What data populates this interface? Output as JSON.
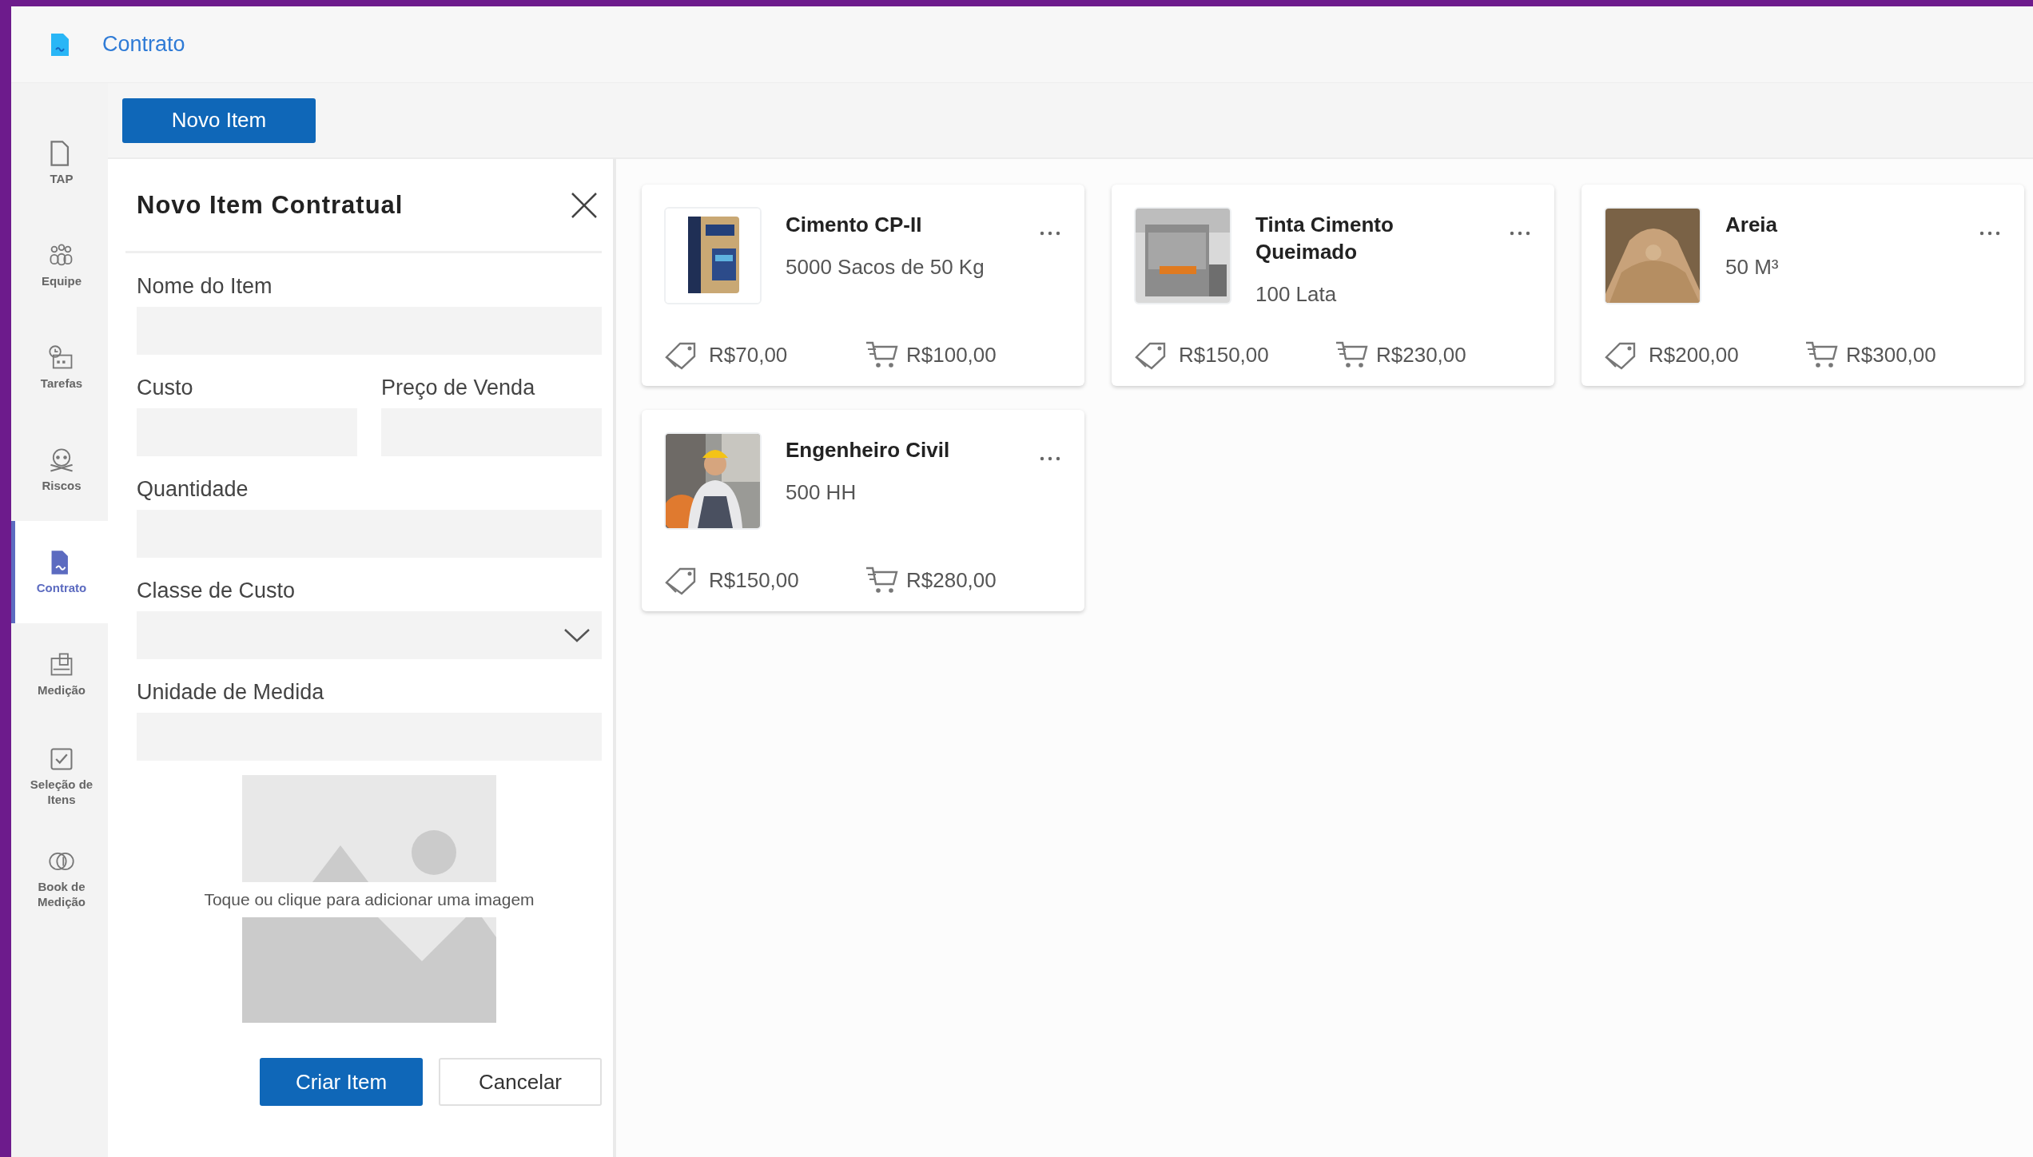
{
  "header": {
    "title": "Contrato"
  },
  "sidebar": {
    "items": [
      {
        "label": "TAP",
        "selected": false
      },
      {
        "label": "Equipe",
        "selected": false
      },
      {
        "label": "Tarefas",
        "selected": false
      },
      {
        "label": "Riscos",
        "selected": false
      },
      {
        "label": "Contrato",
        "selected": true
      },
      {
        "label": "Medição",
        "selected": false
      },
      {
        "label": "Seleção de Itens",
        "selected": false
      },
      {
        "label": "Book de Medição",
        "selected": false
      }
    ]
  },
  "toolbar": {
    "new_button": "Novo Item"
  },
  "form": {
    "title": "Novo Item Contratual",
    "fields": [
      {
        "label": "Nome do Item",
        "kind": "text"
      },
      {
        "label": "Custo",
        "kind": "half"
      },
      {
        "label": "Preço de Venda",
        "kind": "half"
      },
      {
        "label": "Quantidade",
        "kind": "text"
      },
      {
        "label": "Classe de Custo",
        "kind": "dropdown"
      },
      {
        "label": "Unidade de Medida",
        "kind": "text"
      }
    ],
    "image_hint": "Toque ou clique para adicionar uma imagem",
    "submit": "Criar Item",
    "cancel": "Cancelar"
  },
  "cards": [
    {
      "title": "Cimento CP-II",
      "quantity": "5000 Sacos de 50 Kg",
      "cost": "R$70,00",
      "price": "R$100,00",
      "kind": "picture"
    },
    {
      "title": "Tinta Cimento Queimado",
      "quantity": "100 Lata",
      "cost": "R$150,00",
      "price": "R$230,00",
      "kind": "picture"
    },
    {
      "title": "Areia",
      "quantity": "50 M³",
      "cost": "R$200,00",
      "price": "R$300,00",
      "kind": "picture"
    },
    {
      "title": "Engenheiro Civil",
      "quantity": "500 HH",
      "cost": "R$150,00",
      "price": "R$280,00",
      "kind": "picture"
    }
  ]
}
